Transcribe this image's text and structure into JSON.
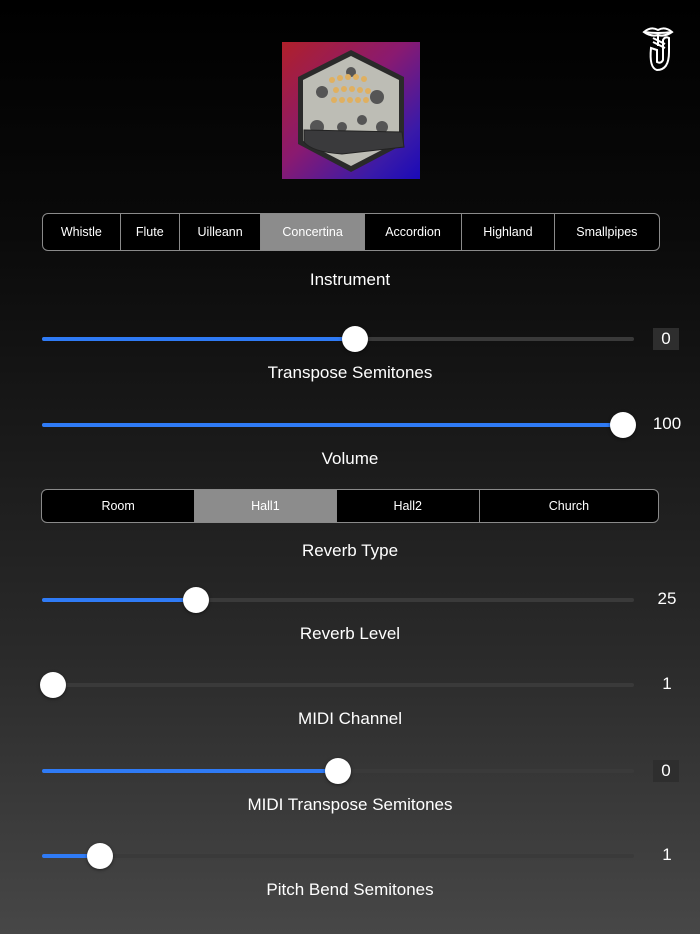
{
  "instrument_tabs": {
    "items": [
      "Whistle",
      "Flute",
      "Uilleann",
      "Concertina",
      "Accordion",
      "Highland",
      "Smallpipes"
    ],
    "selected": 3,
    "label": "Instrument"
  },
  "sliders": [
    {
      "label": "Transpose Semitones",
      "value": "0",
      "fraction": 0.53,
      "boxed": true
    },
    {
      "label": "Volume",
      "value": "100",
      "fraction": 1.0,
      "boxed": false
    }
  ],
  "reverb_tabs": {
    "items": [
      "Room",
      "Hall1",
      "Hall2",
      "Church"
    ],
    "selected": 1,
    "label": "Reverb Type"
  },
  "sliders2": [
    {
      "label": "Reverb Level",
      "value": "25",
      "fraction": 0.25,
      "boxed": false
    },
    {
      "label": "MIDI Channel",
      "value": "1",
      "fraction": 0.0,
      "boxed": false
    },
    {
      "label": "MIDI Transpose Semitones",
      "value": "0",
      "fraction": 0.5,
      "boxed": true
    },
    {
      "label": "Pitch Bend Semitones",
      "value": "1",
      "fraction": 0.083,
      "boxed": false
    }
  ],
  "colors": {
    "accent": "#2f7bf6",
    "selected_segment": "#8c8c8c"
  }
}
